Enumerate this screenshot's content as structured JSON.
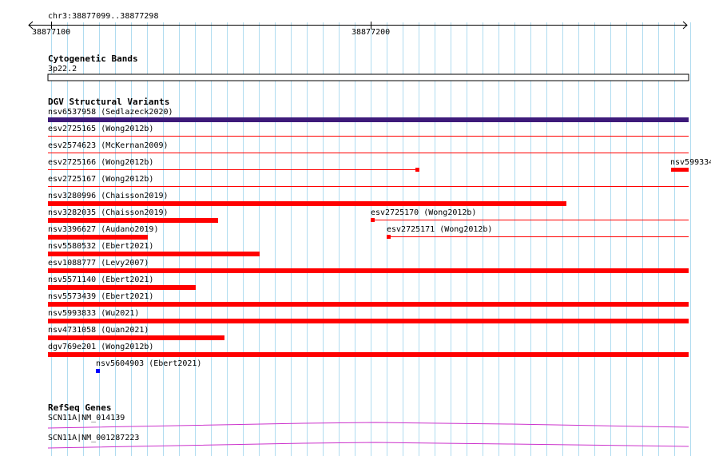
{
  "ruler": {
    "region": "chr3:38877099..38877298",
    "start_label": "38877100",
    "mid_label": "38877200"
  },
  "cytoband": {
    "title": "Cytogenetic Bands",
    "band": "3p22.2"
  },
  "dgv": {
    "title": "DGV Structural Variants",
    "features": [
      {
        "label": "nsv6537958 (Sedlazeck2020)",
        "color": "#3d1a7a"
      },
      {
        "label": "esv2725165 (Wong2012b)",
        "color": "#ff0000"
      },
      {
        "label": "esv2574623 (McKernan2009)",
        "color": "#ff0000"
      },
      {
        "label": "esv2725166 (Wong2012b)",
        "color": "#ff0000"
      },
      {
        "label": "nsv599334",
        "color": "#ff0000"
      },
      {
        "label": "esv2725167 (Wong2012b)",
        "color": "#ff0000"
      },
      {
        "label": "nsv3280996 (Chaisson2019)",
        "color": "#ff0000"
      },
      {
        "label": "nsv3282035 (Chaisson2019)",
        "color": "#ff0000"
      },
      {
        "label": "esv2725170 (Wong2012b)",
        "color": "#ff0000"
      },
      {
        "label": "nsv3396627 (Audano2019)",
        "color": "#ff0000"
      },
      {
        "label": "esv2725171 (Wong2012b)",
        "color": "#ff0000"
      },
      {
        "label": "nsv5580532 (Ebert2021)",
        "color": "#ff0000"
      },
      {
        "label": "esv1088777 (Levy2007)",
        "color": "#ff0000"
      },
      {
        "label": "nsv5571140 (Ebert2021)",
        "color": "#ff0000"
      },
      {
        "label": "nsv5573439 (Ebert2021)",
        "color": "#ff0000"
      },
      {
        "label": "nsv5993833 (Wu2021)",
        "color": "#ff0000"
      },
      {
        "label": "nsv4731058 (Quan2021)",
        "color": "#ff0000"
      },
      {
        "label": "dgv769e201 (Wong2012b)",
        "color": "#ff0000"
      },
      {
        "label": "nsv5604903 (Ebert2021)",
        "color": "#0000ff"
      }
    ]
  },
  "refseq": {
    "title": "RefSeq Genes",
    "transcripts": [
      {
        "label": "SCN11A|NM_014139",
        "color": "#cc33cc"
      },
      {
        "label": "SCN11A|NM_001287223",
        "color": "#cc33cc"
      }
    ]
  },
  "colors": {
    "grid": "#b0dcf0",
    "ruler": "#000000"
  }
}
